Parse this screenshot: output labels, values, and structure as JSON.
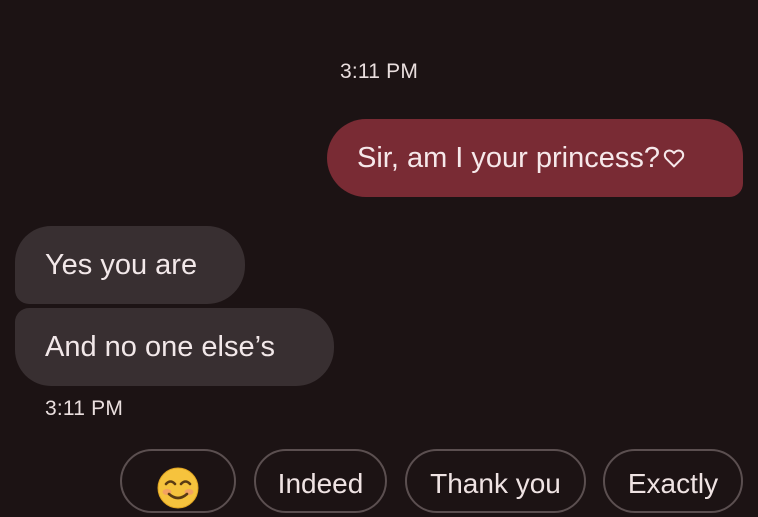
{
  "conversation": {
    "outgoing_timestamp": "3:11 PM",
    "outgoing_message": "Sir, am I your princess?",
    "outgoing_icon": "heart-outline-icon",
    "incoming_messages": [
      "Yes you are",
      "And no one else’s"
    ],
    "incoming_timestamp": "3:11 PM"
  },
  "smart_replies": {
    "emoji_icon": "smiling-face-emoji",
    "items": [
      "Indeed",
      "Thank you",
      "Exactly"
    ]
  },
  "colors": {
    "background": "#1c1314",
    "outgoing_bubble": "#792b34",
    "incoming_bubble": "#382f31",
    "chip_border": "#5b4f50"
  }
}
